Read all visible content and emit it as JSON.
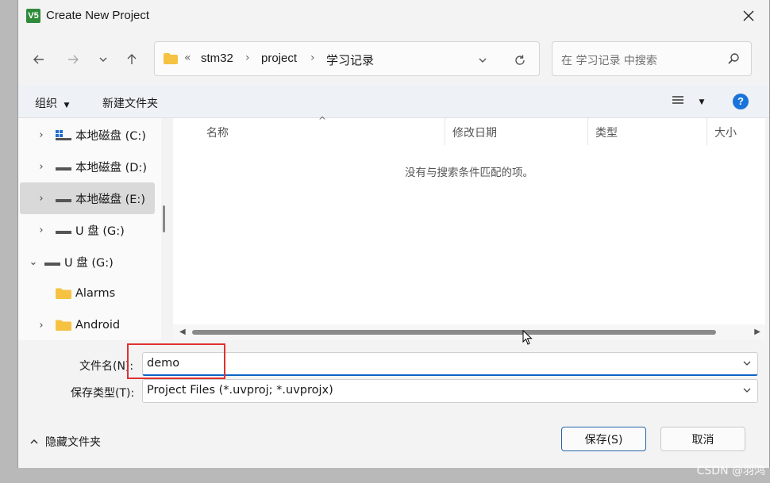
{
  "window": {
    "title": "Create New Project",
    "app_icon_text": "V5"
  },
  "nav": {
    "breadcrumb_prefix": "«",
    "crumbs": [
      "stm32",
      "project",
      "学习记录"
    ],
    "search_placeholder": "在 学习记录 中搜索"
  },
  "toolbar": {
    "organize": "组织",
    "new_folder": "新建文件夹"
  },
  "sidebar": {
    "items": [
      {
        "label": "本地磁盘 (C:)"
      },
      {
        "label": "本地磁盘 (D:)"
      },
      {
        "label": "本地磁盘 (E:)"
      },
      {
        "label": "U 盘 (G:)"
      },
      {
        "label": "U 盘 (G:)"
      },
      {
        "label": "Alarms"
      },
      {
        "label": "Android"
      }
    ]
  },
  "filelist": {
    "columns": [
      "名称",
      "修改日期",
      "类型",
      "大小"
    ],
    "empty_message": "没有与搜索条件匹配的项。"
  },
  "form": {
    "filename_label": "文件名(N):",
    "filename_value": "demo",
    "filetype_label": "保存类型(T):",
    "filetype_value": "Project Files (*.uvproj; *.uvprojx)"
  },
  "footer": {
    "hide_folders": "隐藏文件夹",
    "save": "保存(S)",
    "cancel": "取消"
  },
  "watermark": "CSDN @羽鸿",
  "colors": {
    "accent": "#0b63c4",
    "highlight": "#e03030",
    "folder": "#f5c242"
  }
}
